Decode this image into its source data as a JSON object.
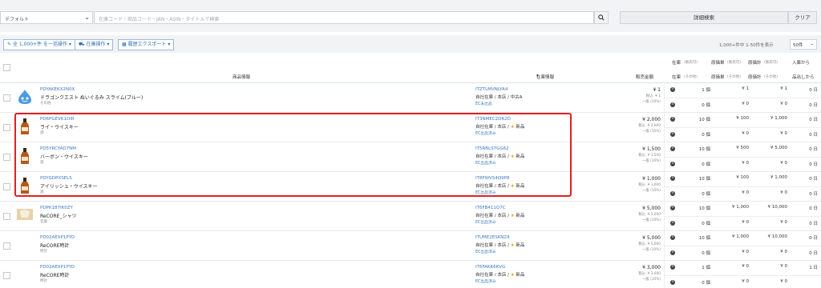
{
  "search": {
    "select_value": "デフォルト",
    "placeholder": "在庫コード・商品コード・JAN・ASIN・タイトルで検索",
    "search_icon": "magnifier-icon",
    "detail_label": "詳細検索",
    "clear_label": "クリア"
  },
  "toolbar": {
    "bulk_label": "全 1,000+件 を一括操作",
    "stock_label": "在庫操作",
    "history_label": "履歴エクスポート",
    "range_info": "1,000+件中 1-50件を表示",
    "per_page": "50件"
  },
  "header": {
    "product_info": "商品情報",
    "stock_info": "在庫情報",
    "sale_amount": "販売金額",
    "col_stock": "在庫",
    "col_stock_sub": "(販売可)",
    "col_cost_unit": "原価単",
    "col_cost_unit_sub": "(販売可)",
    "col_cost_total": "原価計",
    "col_cost_total_sub": "(販売可)",
    "col_incoming": "入庫から",
    "col_stock2": "在庫",
    "col_stock2_sub": "(その他)",
    "col_cost_unit2": "原価単",
    "col_cost_unit2_sub": "(その他)",
    "col_cost_total2": "原価計",
    "col_cost_total2_sub": "(その他)",
    "col_sold": "品出しから"
  },
  "rows": [
    {
      "pid": "PDYAKEKX2N0X",
      "name": "ドラゴンクエスト ぬいぐるみ スライム(ブルー)",
      "cat": "その他",
      "iid": "ITZTLMVNLYA4",
      "status": "自社在庫 / 本店 / 中古A",
      "status_star": "",
      "canon": "EC未出品",
      "price": "¥ 1",
      "tax": "税込: ¥ 1",
      "rate": "一般 (10%)",
      "a": {
        "s": "1 個",
        "cu": "¥ 1",
        "ct": "¥ 1",
        "d": "0 日"
      },
      "b": {
        "s": "0 個",
        "cu": "¥ 0",
        "ct": "¥ 0",
        "d": "0 日"
      }
    },
    {
      "pid": "PD6PGEVK1DIR",
      "name": "ライ・ウイスキー",
      "cat": "酒",
      "iid": "IT3NMEC2DR2D",
      "status": "自社在庫 / 本店 / ",
      "status_star": "新品",
      "canon": "EC出品済み",
      "price": "¥ 2,000",
      "tax": "税込: ¥ 2,000",
      "rate": "一般 (10%)",
      "a": {
        "s": "10 個",
        "cu": "¥ 100",
        "ct": "¥ 1,000",
        "d": "0 日"
      },
      "b": {
        "s": "0 個",
        "cu": "¥ 0",
        "ct": "¥ 0",
        "d": "0 日"
      }
    },
    {
      "pid": "PD5YRCYAD7NM",
      "name": "バーボン・ウイスキー",
      "cat": "酒",
      "iid": "IT5RBLS7GG62",
      "status": "自社在庫 / 本店 / ",
      "status_star": "新品",
      "canon": "EC出品済み",
      "price": "¥ 1,500",
      "tax": "税込: ¥ 1,500",
      "rate": "一般 (10%)",
      "a": {
        "s": "10 個",
        "cu": "¥ 500",
        "ct": "¥ 5,000",
        "d": "0 日"
      },
      "b": {
        "s": "0 個",
        "cu": "¥ 0",
        "ct": "¥ 0",
        "d": "0 日"
      }
    },
    {
      "pid": "PDYGDPXSELS",
      "name": "アイリッシュ・ウイスキー",
      "cat": "酒",
      "iid": "IT8FWVS4Q9P8",
      "status": "自社在庫 / 本店 / ",
      "status_star": "新品",
      "canon": "EC出品済み",
      "price": "¥ 1,000",
      "tax": "税込: ¥ 1,000",
      "rate": "一般 (10%)",
      "a": {
        "s": "10 個",
        "cu": "¥ 100",
        "ct": "¥ 1,000",
        "d": "0 日"
      },
      "b": {
        "s": "0 個",
        "cu": "¥ 0",
        "ct": "¥ 0",
        "d": "0 日"
      }
    },
    {
      "pid": "PDPK187IK0ZY",
      "name": "ReCORE_シャツ",
      "cat": "衣服",
      "iid": "IT6FB411Q7C",
      "status": "自社在庫 / 本店 / ",
      "status_star": "新品",
      "canon": "EC出品済み",
      "price": "¥ 5,000",
      "tax": "税込: ¥ 5,000",
      "rate": "一般 (10%)",
      "a": {
        "s": "10 個",
        "cu": "¥ 1,000",
        "ct": "¥ 10,000",
        "d": "0 日"
      },
      "b": {
        "s": "0 個",
        "cu": "¥ 0",
        "ct": "¥ 0",
        "d": "0 日"
      }
    },
    {
      "pid": "PD02AEXP1PYO",
      "name": "ReCORE時計",
      "cat": "時計",
      "iid": "ITUME2ESKNZ4",
      "status": "自社在庫 / 本店 / ",
      "status_star": "新品",
      "canon": "EC出品済み",
      "price": "¥ 5,000",
      "tax": "税込: ¥ 5,000",
      "rate": "一般 (10%)",
      "a": {
        "s": "10 個",
        "cu": "¥ 1,000",
        "ct": "¥ 10,000",
        "d": "0 日"
      },
      "b": {
        "s": "0 個",
        "cu": "¥ 0",
        "ct": "¥ 0",
        "d": "0 日"
      }
    },
    {
      "pid": "PD02AEXP1PYO",
      "name": "ReCORE時計",
      "cat": "時計",
      "iid": "IT6FAKK6KVG",
      "status": "自社在庫 / 本店 / ",
      "status_star": "新品",
      "canon": "EC出品済み",
      "price": "¥ 3,000",
      "tax": "税込: ¥ 3,000",
      "rate": "一般 (10%)",
      "a": {
        "s": "1 個",
        "cu": "¥ 0",
        "ct": "¥ 0",
        "d": "1 日"
      },
      "b": {
        "s": "0 個",
        "cu": "¥ 0",
        "ct": "¥ 0",
        "d": ""
      }
    }
  ]
}
